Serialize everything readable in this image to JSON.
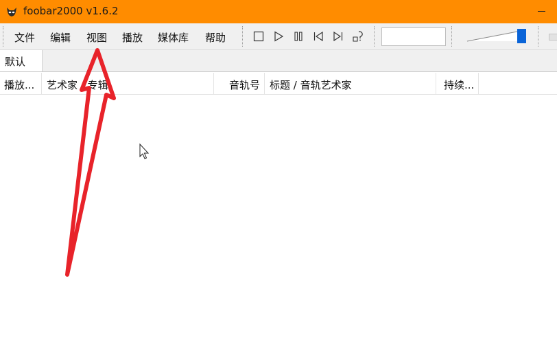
{
  "window": {
    "title": "foobar2000 v1.6.2",
    "app_icon": "foobar-alien-icon"
  },
  "menu": [
    {
      "label": "文件"
    },
    {
      "label": "编辑"
    },
    {
      "label": "视图"
    },
    {
      "label": "播放"
    },
    {
      "label": "媒体库"
    },
    {
      "label": "帮助"
    }
  ],
  "toolbar": {
    "buttons": [
      "stop-icon",
      "play-icon",
      "pause-icon",
      "previous-icon",
      "next-icon",
      "random-icon"
    ]
  },
  "tabs": [
    {
      "label": "默认"
    }
  ],
  "columns": [
    {
      "label": "播放..."
    },
    {
      "label": "艺术家 / 专辑"
    },
    {
      "label": "音轨号"
    },
    {
      "label": "标题 / 音轨艺术家"
    },
    {
      "label": "持续..."
    }
  ],
  "colors": {
    "titlebar": "#ff8c00",
    "annotation_arrow": "#e8232a",
    "volume_thumb": "#0a64d8"
  }
}
